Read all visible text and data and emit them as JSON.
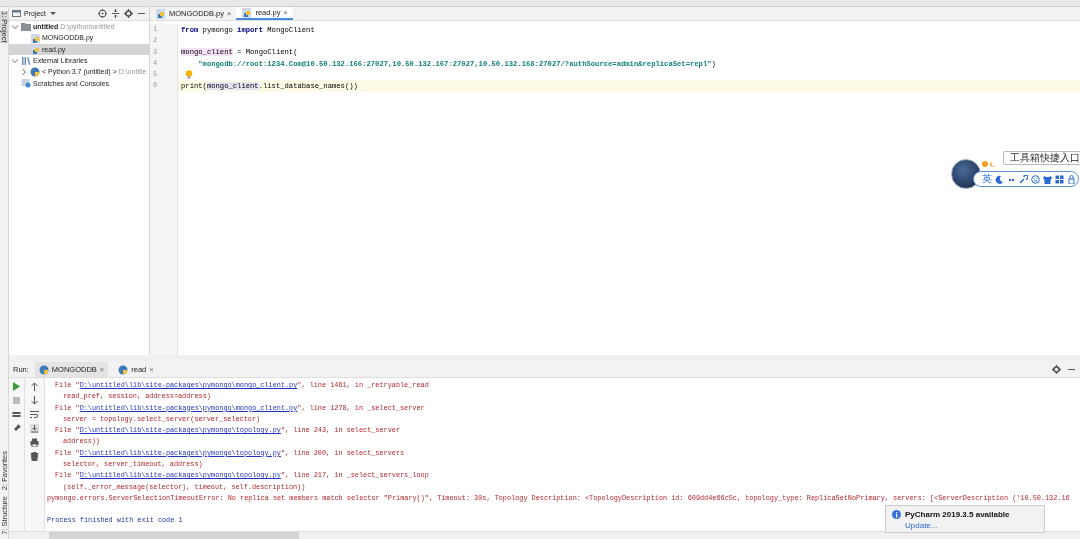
{
  "tool_strip": {
    "top": [
      {
        "label": "1: Project",
        "selected": true
      }
    ],
    "bottom": [
      {
        "label": "2: Favorites",
        "selected": false
      },
      {
        "label": "7: Structure",
        "selected": false
      }
    ]
  },
  "project_panel": {
    "title": "Project",
    "tree": [
      {
        "label": "untitled",
        "path": "D:\\python\\untitled",
        "kind": "folder",
        "expanded": true,
        "selected": false,
        "children": [
          {
            "label": "MONGODDB.py",
            "kind": "file",
            "selected": false
          },
          {
            "label": "read.py",
            "kind": "file",
            "selected": true
          }
        ]
      },
      {
        "label": "External Libraries",
        "kind": "library",
        "expanded": true,
        "selected": false,
        "children": [
          {
            "label": "< Python 3.7 (untitled) >",
            "path": "D:\\untitle",
            "kind": "sdk",
            "expanded": false,
            "selected": false
          }
        ]
      },
      {
        "label": "Scratches and Consoles",
        "kind": "scratch",
        "selected": false
      }
    ]
  },
  "editor": {
    "tabs": [
      {
        "label": "MONGODDB.py",
        "close": "×",
        "selected": false
      },
      {
        "label": "read.py",
        "close": "×",
        "selected": true
      }
    ],
    "lines": [
      {
        "number": "1",
        "current": false,
        "tokens": [
          {
            "text": "from",
            "kind": "keyword"
          },
          {
            "text": " pymongo ",
            "kind": "plain"
          },
          {
            "text": "import",
            "kind": "keyword"
          },
          {
            "text": " MongoClient",
            "kind": "plain"
          }
        ]
      },
      {
        "number": "2",
        "current": false
      },
      {
        "number": "3",
        "current": false,
        "tokens": [
          {
            "text": "mongo_client",
            "kind": "local"
          },
          {
            "text": " = MongoClient(",
            "kind": "plain"
          }
        ]
      },
      {
        "number": "4",
        "current": false,
        "tokens": [
          {
            "text": "    \"mongodb://root:1234.Com@10.50.132.166:27027,10.50.132.167:27027,10.50.132.168:27027/?authSource=admin&replicaSet=repl\"",
            "kind": "string"
          },
          {
            "text": ")",
            "kind": "plain"
          }
        ]
      },
      {
        "number": "5",
        "current": false,
        "bulb": true
      },
      {
        "number": "6",
        "current": true,
        "tokens": [
          {
            "text": "print(",
            "kind": "plain"
          },
          {
            "text": "mongo_client",
            "kind": "usage"
          },
          {
            "text": ".list_database_names())",
            "kind": "plain"
          }
        ]
      }
    ]
  },
  "run_panel": {
    "label": "Run:",
    "tabs": [
      {
        "label": "MONGODDB",
        "close": "×",
        "selected": true
      },
      {
        "label": "read",
        "close": "×",
        "selected": false
      }
    ],
    "output": [
      {
        "kind": "file",
        "prefix": "File \"",
        "link": "D:\\untitled\\lib\\site-packages\\pymongo\\mongo_client.py",
        "suffix": "\", line 1461, in _retryable_read"
      },
      {
        "kind": "code",
        "text": "read_pref, session, address=address)"
      },
      {
        "kind": "file",
        "prefix": "File \"",
        "link": "D:\\untitled\\lib\\site-packages\\pymongo\\mongo_client.py",
        "suffix": "\", line 1278, in _select_server"
      },
      {
        "kind": "code",
        "text": "server = topology.select_server(server_selector)"
      },
      {
        "kind": "file",
        "prefix": "File \"",
        "link": "D:\\untitled\\lib\\site-packages\\pymongo\\topology.py",
        "suffix": "\", line 243, in select_server"
      },
      {
        "kind": "code",
        "text": "address))"
      },
      {
        "kind": "file",
        "prefix": "File \"",
        "link": "D:\\untitled\\lib\\site-packages\\pymongo\\topology.py",
        "suffix": "\", line 200, in select_servers"
      },
      {
        "kind": "code",
        "text": "selector, server_timeout, address)"
      },
      {
        "kind": "file",
        "prefix": "File \"",
        "link": "D:\\untitled\\lib\\site-packages\\pymongo\\topology.py",
        "suffix": "\", line 217, in _select_servers_loop"
      },
      {
        "kind": "code",
        "text": "(self._error_message(selector), timeout, self.description))"
      },
      {
        "kind": "error",
        "text": "pymongo.errors.ServerSelectionTimeoutError: No replica set members match selector \"Primary()\", Timeout: 30s, Topology Description: <TopologyDescription id: 609dd4e66c5c, topology_type: ReplicaSetNoPrimary, servers: [<ServerDescription ('10.50.132.16"
      },
      {
        "kind": "info",
        "text": "Process finished with exit code 1"
      }
    ]
  },
  "ime_toolbar": {
    "tooltip": "工具箱快捷入口",
    "key_label": "英"
  },
  "notification": {
    "title": "PyCharm 2019.3.5 available",
    "link": "Update..."
  }
}
